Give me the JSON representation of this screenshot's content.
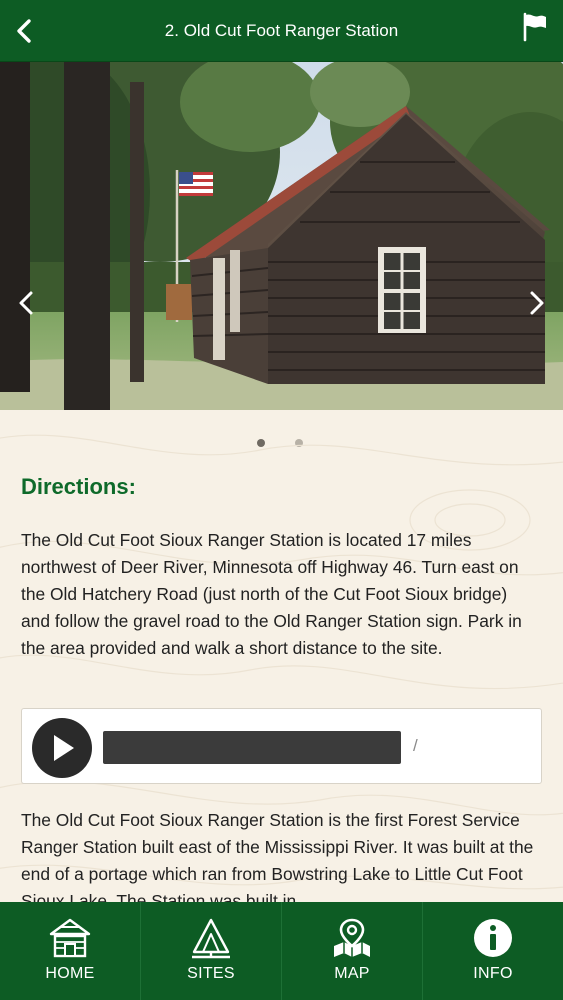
{
  "header": {
    "title": "2. Old Cut Foot Ranger Station",
    "back_icon": "chevron-left-icon",
    "action_icon": "flag-icon"
  },
  "carousel": {
    "image": "old-cut-foot-ranger-station-log-cabin-photo",
    "prev_icon": "chevron-left-icon",
    "next_icon": "chevron-right-icon",
    "page_count": 2,
    "active_page": 1
  },
  "directions": {
    "heading": "Directions:",
    "text": " The Old Cut Foot Sioux Ranger Station is located 17 miles northwest of Deer River, Minnesota off Highway 46.  Turn east on the Old Hatchery Road (just north of the Cut Foot Sioux bridge) and follow the gravel road to the Old Ranger Station sign. Park in the area provided and walk a short distance to the site."
  },
  "audio_player": {
    "play_icon": "play-icon",
    "time_text": "/"
  },
  "description": {
    "text": " The Old Cut Foot Sioux Ranger Station is the first Forest Service Ranger Station built east of the Mississippi River.  It was built at the end of a portage which ran from Bowstring Lake to Little Cut Foot Sioux Lake. The Station was built in"
  },
  "tabbar": {
    "items": [
      {
        "label": "HOME",
        "icon": "home-icon"
      },
      {
        "label": "SITES",
        "icon": "sites-icon"
      },
      {
        "label": "MAP",
        "icon": "map-icon"
      },
      {
        "label": "INFO",
        "icon": "info-icon"
      }
    ]
  },
  "colors": {
    "brand_green": "#0d5c24",
    "heading_green": "#0e6a2a",
    "background": "#f7f1e6"
  }
}
